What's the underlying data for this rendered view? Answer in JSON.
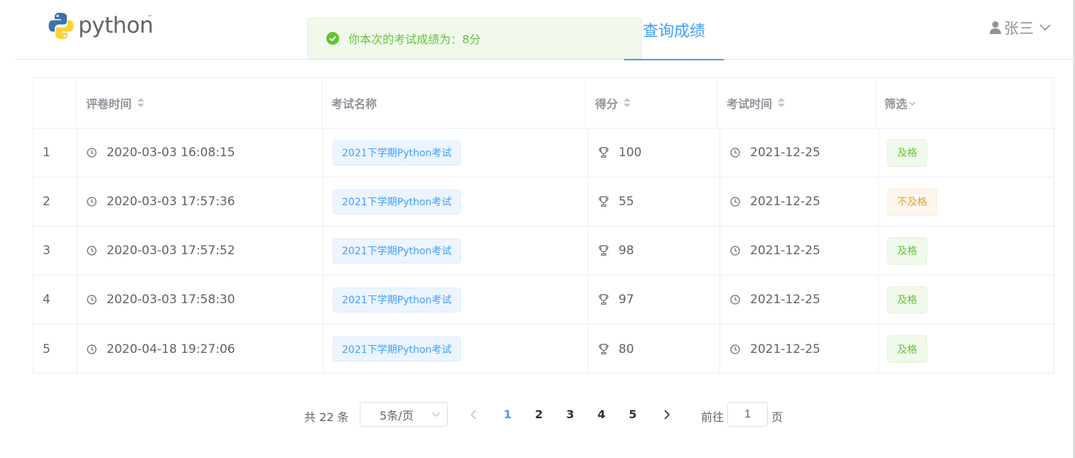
{
  "header": {
    "logo_text": "python",
    "logo_tm": "™",
    "active_tab": "查询成绩",
    "user_name": "张三"
  },
  "toast": {
    "message": "你本次的考试成绩为：8分",
    "type": "success"
  },
  "table": {
    "columns": [
      "",
      "评卷时间",
      "考试名称",
      "得分",
      "考试时间",
      "筛选"
    ],
    "rows": [
      {
        "index": "1",
        "review_time": "2020-03-03 16:08:15",
        "exam_name": "2021下学期Python考试",
        "score": "100",
        "exam_date": "2021-12-25",
        "status": "及格",
        "status_type": "pass"
      },
      {
        "index": "2",
        "review_time": "2020-03-03 17:57:36",
        "exam_name": "2021下学期Python考试",
        "score": "55",
        "exam_date": "2021-12-25",
        "status": "不及格",
        "status_type": "fail"
      },
      {
        "index": "3",
        "review_time": "2020-03-03 17:57:52",
        "exam_name": "2021下学期Python考试",
        "score": "98",
        "exam_date": "2021-12-25",
        "status": "及格",
        "status_type": "pass"
      },
      {
        "index": "4",
        "review_time": "2020-03-03 17:58:30",
        "exam_name": "2021下学期Python考试",
        "score": "97",
        "exam_date": "2021-12-25",
        "status": "及格",
        "status_type": "pass"
      },
      {
        "index": "5",
        "review_time": "2020-04-18 19:27:06",
        "exam_name": "2021下学期Python考试",
        "score": "80",
        "exam_date": "2021-12-25",
        "status": "及格",
        "status_type": "pass"
      }
    ]
  },
  "pagination": {
    "total_text": "共 22 条",
    "page_size": "5条/页",
    "pages": [
      "1",
      "2",
      "3",
      "4",
      "5"
    ],
    "current_page": "1",
    "goto_label": "前往",
    "goto_value": "1",
    "goto_unit": "页"
  },
  "colors": {
    "primary": "#409eff",
    "success": "#67c23a",
    "warning": "#e6a23c",
    "border": "#ebeef5"
  },
  "icons": {
    "toast": "check-circle-icon",
    "user": "user-icon",
    "clock": "clock-icon",
    "trophy": "trophy-icon"
  }
}
